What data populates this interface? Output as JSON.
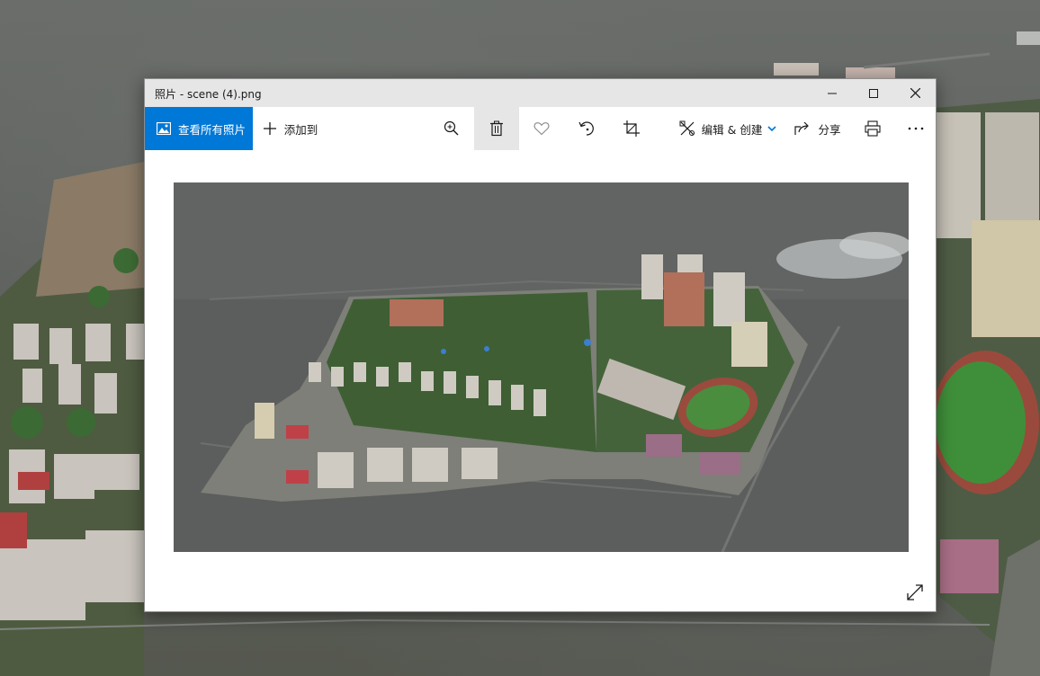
{
  "window": {
    "title": "照片 - scene (4).png",
    "controls": [
      "minimize",
      "maximize",
      "close"
    ]
  },
  "toolbar": {
    "view_all_label": "查看所有照片",
    "add_to_label": "添加到",
    "edit_create_label": "编辑 & 创建",
    "share_label": "分享",
    "icons": [
      "photos-icon",
      "plus-icon",
      "zoom-icon",
      "delete-icon",
      "favorite-icon",
      "rotate-icon",
      "crop-icon",
      "edit-create-icon",
      "chevron-down-icon",
      "share-icon",
      "print-icon",
      "more-icon"
    ]
  },
  "colors": {
    "accent": "#0078d7",
    "titlebar": "#e6e6e6",
    "selected_tool_bg": "#e6e6e6"
  },
  "viewer": {
    "expand_icon": "expand-icon"
  }
}
